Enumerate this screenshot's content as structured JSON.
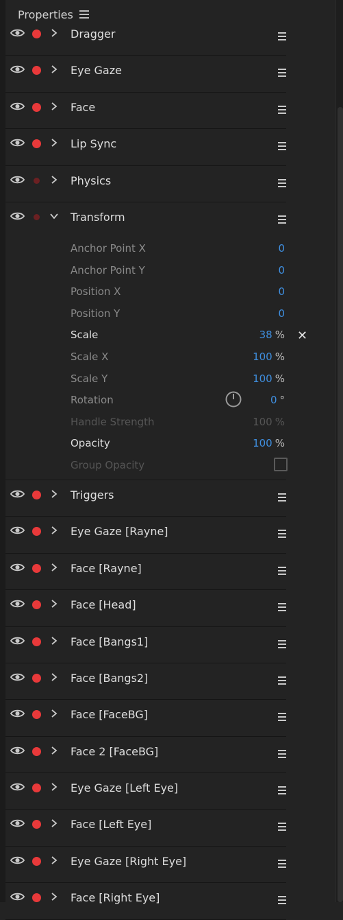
{
  "panel": {
    "title": "Properties"
  },
  "layers": [
    {
      "label": "Dragger",
      "dot": "bright"
    },
    {
      "label": "Eye Gaze",
      "dot": "bright"
    },
    {
      "label": "Face",
      "dot": "bright"
    },
    {
      "label": "Lip Sync",
      "dot": "bright"
    },
    {
      "label": "Physics",
      "dot": "dim"
    },
    {
      "label": "Transform",
      "dot": "dim",
      "expanded": true
    },
    {
      "label": "Triggers",
      "dot": "bright"
    },
    {
      "label": "Eye Gaze [Rayne]",
      "dot": "bright"
    },
    {
      "label": "Face [Rayne]",
      "dot": "bright"
    },
    {
      "label": "Face [Head]",
      "dot": "bright"
    },
    {
      "label": "Face [Bangs1]",
      "dot": "bright"
    },
    {
      "label": "Face [Bangs2]",
      "dot": "bright"
    },
    {
      "label": "Face [FaceBG]",
      "dot": "bright"
    },
    {
      "label": "Face 2 [FaceBG]",
      "dot": "bright"
    },
    {
      "label": "Eye Gaze [Left Eye]",
      "dot": "bright"
    },
    {
      "label": "Face [Left Eye]",
      "dot": "bright"
    },
    {
      "label": "Eye Gaze [Right Eye]",
      "dot": "bright"
    },
    {
      "label": "Face [Right Eye]",
      "dot": "bright"
    }
  ],
  "transform": {
    "anchor_x": {
      "name": "Anchor Point X",
      "value": "0"
    },
    "anchor_y": {
      "name": "Anchor Point Y",
      "value": "0"
    },
    "position_x": {
      "name": "Position X",
      "value": "0"
    },
    "position_y": {
      "name": "Position Y",
      "value": "0"
    },
    "scale": {
      "name": "Scale",
      "value": "38",
      "unit": "%"
    },
    "scale_x": {
      "name": "Scale X",
      "value": "100",
      "unit": "%"
    },
    "scale_y": {
      "name": "Scale Y",
      "value": "100",
      "unit": "%"
    },
    "rotation": {
      "name": "Rotation",
      "value": "0",
      "unit": "°"
    },
    "handle_strength": {
      "name": "Handle Strength",
      "value": "100",
      "unit": "%"
    },
    "opacity": {
      "name": "Opacity",
      "value": "100",
      "unit": "%"
    },
    "group_opacity": {
      "name": "Group Opacity",
      "checked": false
    }
  },
  "colors": {
    "accent": "#3f8fe0",
    "record_dot": "#e8393a",
    "record_dot_dim": "#6b2022",
    "background": "#232323"
  },
  "icons": {
    "visibility": "eye-icon",
    "record": "record-dot-icon",
    "expand": "chevron-right-icon",
    "collapse": "chevron-down-icon",
    "menu": "hamburger-menu-icon",
    "reset": "close-x-icon",
    "dial": "rotation-dial-icon"
  }
}
